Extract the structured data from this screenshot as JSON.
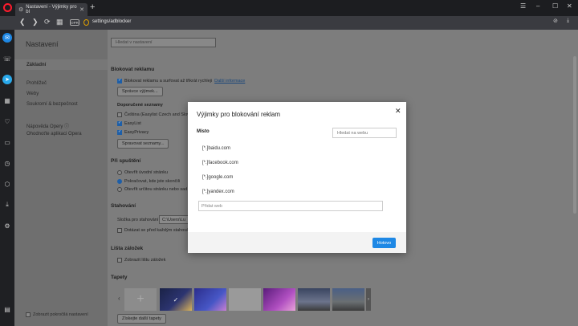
{
  "browser": {
    "tab_title": "Nastavení - Výjimky pro bl",
    "url": "settings/adblocker",
    "url_chip": "OPR"
  },
  "settings": {
    "title": "Nastavení",
    "search_placeholder": "Hledat v nastavení",
    "nav": {
      "basic": "Základní",
      "browser": "Prohlížeč",
      "websites": "Weby",
      "privacy": "Soukromí & bezpečnost",
      "help": "Nápověda Opery",
      "update": "Ohodnoťte aplikaci Opera",
      "advanced": "Zobrazit pokročilá nastavení"
    },
    "adblock": {
      "title": "Blokovat reklamu",
      "enable_label": "Blokovat reklamu a surfovat až třikrát rychleji",
      "more_info": "Další informace",
      "manage_exceptions": "Správce výjimek...",
      "lists_title": "Doporučené seznamy",
      "lists": [
        "Čeština (Easylist Czech and Slov",
        "EasyList",
        "EasyPrivacy"
      ],
      "manage_lists": "Spravovat seznamy..."
    },
    "startup": {
      "title": "Při spuštění",
      "options": [
        "Otevřít úvodní stránku",
        "Pokračovat, kde jste skončili",
        "Otevřít určitou stránku nebo sad"
      ]
    },
    "downloads": {
      "title": "Stahování",
      "folder_label": "Složka pro stahování",
      "folder_value": "C:\\Users\\Lu",
      "ask_label": "Dotázat se před každým stahová"
    },
    "bookmarks": {
      "title": "Lišta záložek",
      "show_label": "Zobrazit lištu záložek"
    },
    "wallpapers": {
      "title": "Tapety",
      "get_more": "Získejte další tapety"
    }
  },
  "modal": {
    "title": "Výjimky pro blokování reklam",
    "column_header": "Místo",
    "search_placeholder": "Hledat na webu",
    "sites": [
      "[*.]baidu.com",
      "[*.]facebook.com",
      "[*.]google.com",
      "[*.]yandex.com"
    ],
    "add_placeholder": "Přidat web",
    "done_button": "Hotovo"
  }
}
